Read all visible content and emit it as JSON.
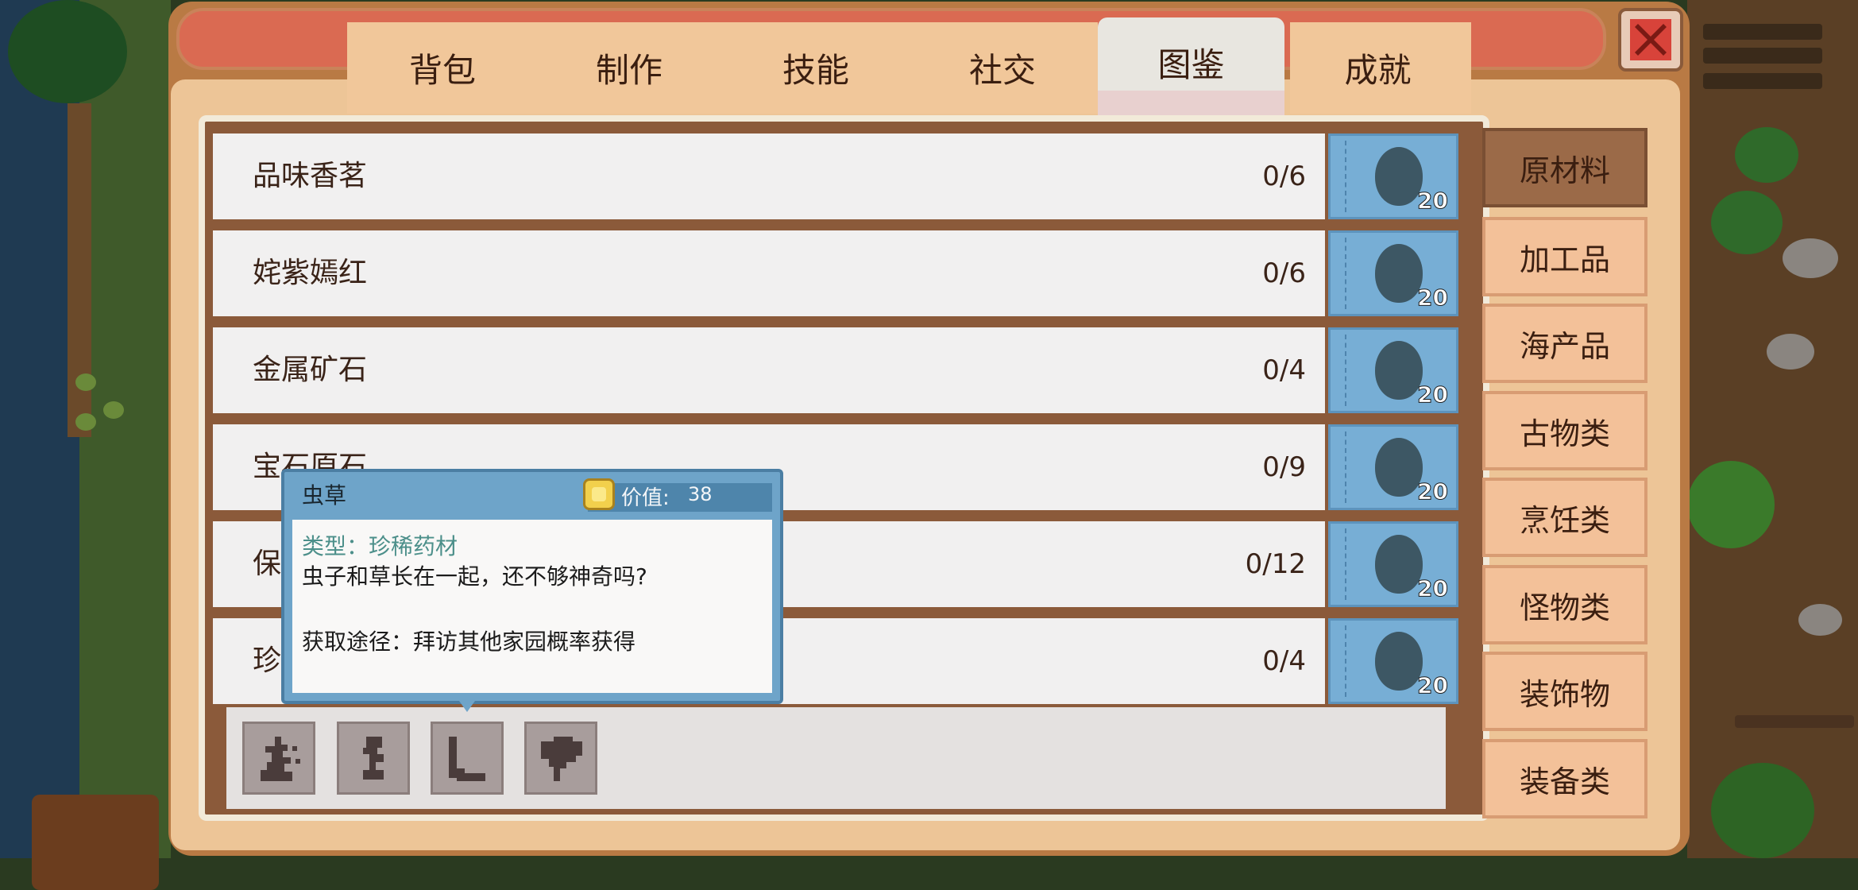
{
  "tabs": [
    {
      "label": "背包"
    },
    {
      "label": "制作"
    },
    {
      "label": "技能"
    },
    {
      "label": "社交"
    },
    {
      "label": "图鉴"
    },
    {
      "label": "成就"
    }
  ],
  "active_tab": "图鉴",
  "rows": [
    {
      "name": "品味香茗",
      "count": "0/6",
      "slot_count": "20"
    },
    {
      "name": "姹紫嫣红",
      "count": "0/6",
      "slot_count": "20"
    },
    {
      "name": "金属矿石",
      "count": "0/4",
      "slot_count": "20"
    },
    {
      "name": "宝石原石",
      "count": "0/9",
      "slot_count": "20"
    },
    {
      "name": "保",
      "count": "0/12",
      "slot_count": "20"
    },
    {
      "name": "珍",
      "count": "0/4",
      "slot_count": "20"
    }
  ],
  "categories": [
    {
      "label": "原材料"
    },
    {
      "label": "加工品"
    },
    {
      "label": "海产品"
    },
    {
      "label": "古物类"
    },
    {
      "label": "烹饪类"
    },
    {
      "label": "怪物类"
    },
    {
      "label": "装饰物"
    },
    {
      "label": "装备类"
    }
  ],
  "active_category": "原材料",
  "collection_items": [
    {
      "icon": "cordyceps-silhouette-icon"
    },
    {
      "icon": "herb-silhouette-icon"
    },
    {
      "icon": "root-silhouette-icon"
    },
    {
      "icon": "mushroom-silhouette-icon"
    }
  ],
  "tooltip": {
    "name": "虫草",
    "value_label": "价值:",
    "value": "38",
    "type": "类型：珍稀药材",
    "description": "虫子和草长在一起，还不够神奇吗?",
    "source": "获取途径：拜访其他家园概率获得"
  },
  "colors": {
    "panel": "#edc597",
    "tab_active": "#e8e6e0",
    "slot": "#77aed5",
    "category_active": "#9b6a48",
    "category": "#f3c199",
    "tooltip_frame": "#6ea4c9",
    "close_button": "#d8433a"
  }
}
